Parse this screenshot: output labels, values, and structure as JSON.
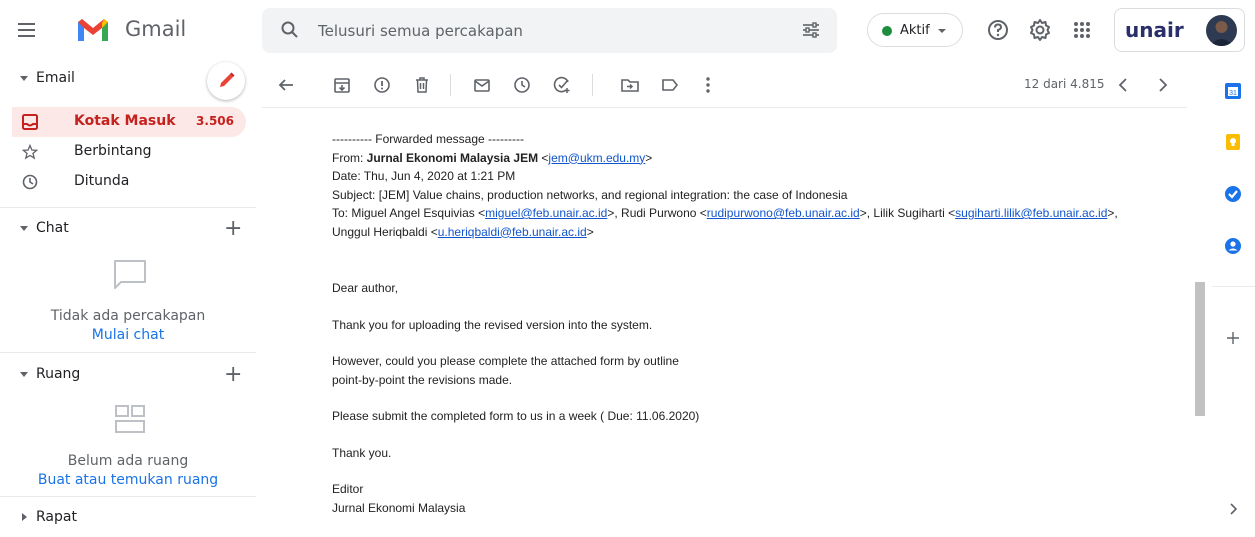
{
  "app": {
    "name": "Gmail"
  },
  "search": {
    "placeholder": "Telusuri semua percakapan"
  },
  "status": {
    "label": "Aktif",
    "color": "#1e8e3e"
  },
  "brand": {
    "wordmark": "unair"
  },
  "sidebar": {
    "email_header": "Email",
    "items": [
      {
        "label": "Kotak Masuk",
        "count": "3.506",
        "icon": "inbox-icon",
        "active": true
      },
      {
        "label": "Berbintang",
        "count": "",
        "icon": "star-icon"
      },
      {
        "label": "Ditunda",
        "count": "",
        "icon": "clock-icon"
      }
    ],
    "chat_header": "Chat",
    "chat_empty": "Tidak ada percakapan",
    "chat_action": "Mulai chat",
    "rooms_header": "Ruang",
    "rooms_empty": "Belum ada ruang",
    "rooms_action": "Buat atau temukan ruang",
    "meet_header": "Rapat"
  },
  "toolbar": {
    "pager": "12 dari 4.815"
  },
  "message": {
    "fwd": "---------- Forwarded message ---------",
    "from_label": "From: ",
    "from_name": "Jurnal Ekonomi Malaysia JEM",
    "from_email": "jem@ukm.edu.my",
    "date": "Date: Thu, Jun 4, 2020 at 1:21 PM",
    "subject": "Subject: [JEM] Value chains, production networks, and regional integration: the case of Indonesia",
    "to_label": "To: ",
    "r1_name": "Miguel Angel Esquivias ",
    "r1_email": "miguel@feb.unair.ac.id",
    "r2_name": "Rudi Purwono ",
    "r2_email": "rudipurwono@feb.unair.ac.id",
    "r3_name": "Lilik Sugiharti ",
    "r3_email": "sugiharti.lilik@feb.unair.ac.id",
    "r4_name": "Unggul Heriqbaldi ",
    "r4_email": "u.heriqbaldi@feb.unair.ac.id",
    "greeting": "Dear author,",
    "p1": "Thank you for uploading the revised version into the system.",
    "p2a": "However, could you please complete the attached form by outline",
    "p2b": "point-by-point the revisions made.",
    "p3": "Please submit the completed form to us in a week ( Due: 11.06.2020)",
    "thanks": "Thank you.",
    "sig1": "Editor",
    "sig2": "Jurnal Ekonomi Malaysia"
  }
}
